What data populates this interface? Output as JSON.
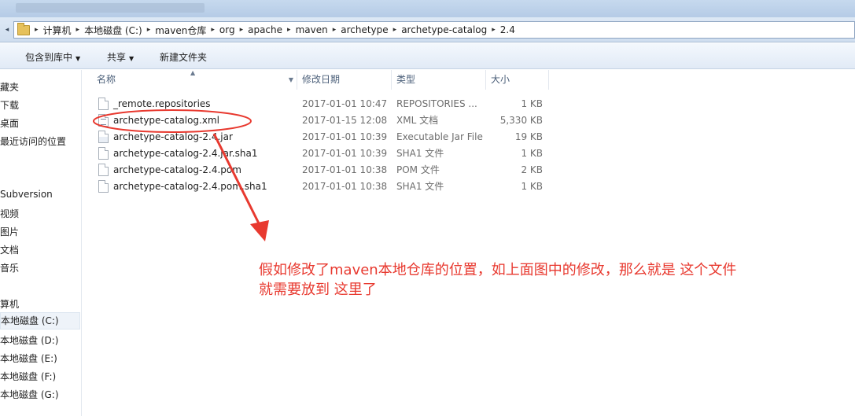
{
  "address": {
    "crumbs": [
      "计算机",
      "本地磁盘 (C:)",
      "maven仓库",
      "org",
      "apache",
      "maven",
      "archetype",
      "archetype-catalog",
      "2.4"
    ]
  },
  "toolbar": {
    "include_label": "包含到库中",
    "share_label": "共享",
    "new_folder_label": "新建文件夹"
  },
  "nav": {
    "items": [
      "藏夹",
      "下载",
      "桌面",
      "最近访问的位置",
      "Subversion",
      "视频",
      "图片",
      "文档",
      "音乐",
      "算机",
      "本地磁盘 (C:)",
      "本地磁盘 (D:)",
      "本地磁盘 (E:)",
      "本地磁盘 (F:)",
      "本地磁盘 (G:)"
    ]
  },
  "columns": {
    "name": "名称",
    "date": "修改日期",
    "type": "类型",
    "size": "大小"
  },
  "files": [
    {
      "name": "_remote.repositories",
      "date": "2017-01-01 10:47",
      "type": "REPOSITORIES ...",
      "size": "1 KB",
      "icon": "file-icon"
    },
    {
      "name": "archetype-catalog.xml",
      "date": "2017-01-15 12:08",
      "type": "XML 文档",
      "size": "5,330 KB",
      "icon": "xml-file-icon"
    },
    {
      "name": "archetype-catalog-2.4.jar",
      "date": "2017-01-01 10:39",
      "type": "Executable Jar File",
      "size": "19 KB",
      "icon": "jar-file-icon"
    },
    {
      "name": "archetype-catalog-2.4.jar.sha1",
      "date": "2017-01-01 10:39",
      "type": "SHA1 文件",
      "size": "1 KB",
      "icon": "file-icon"
    },
    {
      "name": "archetype-catalog-2.4.pom",
      "date": "2017-01-01 10:38",
      "type": "POM 文件",
      "size": "2 KB",
      "icon": "file-icon"
    },
    {
      "name": "archetype-catalog-2.4.pom.sha1",
      "date": "2017-01-01 10:38",
      "type": "SHA1 文件",
      "size": "1 KB",
      "icon": "file-icon"
    }
  ],
  "annotation": {
    "line1": "假如修改了maven本地仓库的位置，如上面图中的修改，那么就是 这个文件",
    "line2": "就需要放到 这里了",
    "color": "#e8392f"
  }
}
